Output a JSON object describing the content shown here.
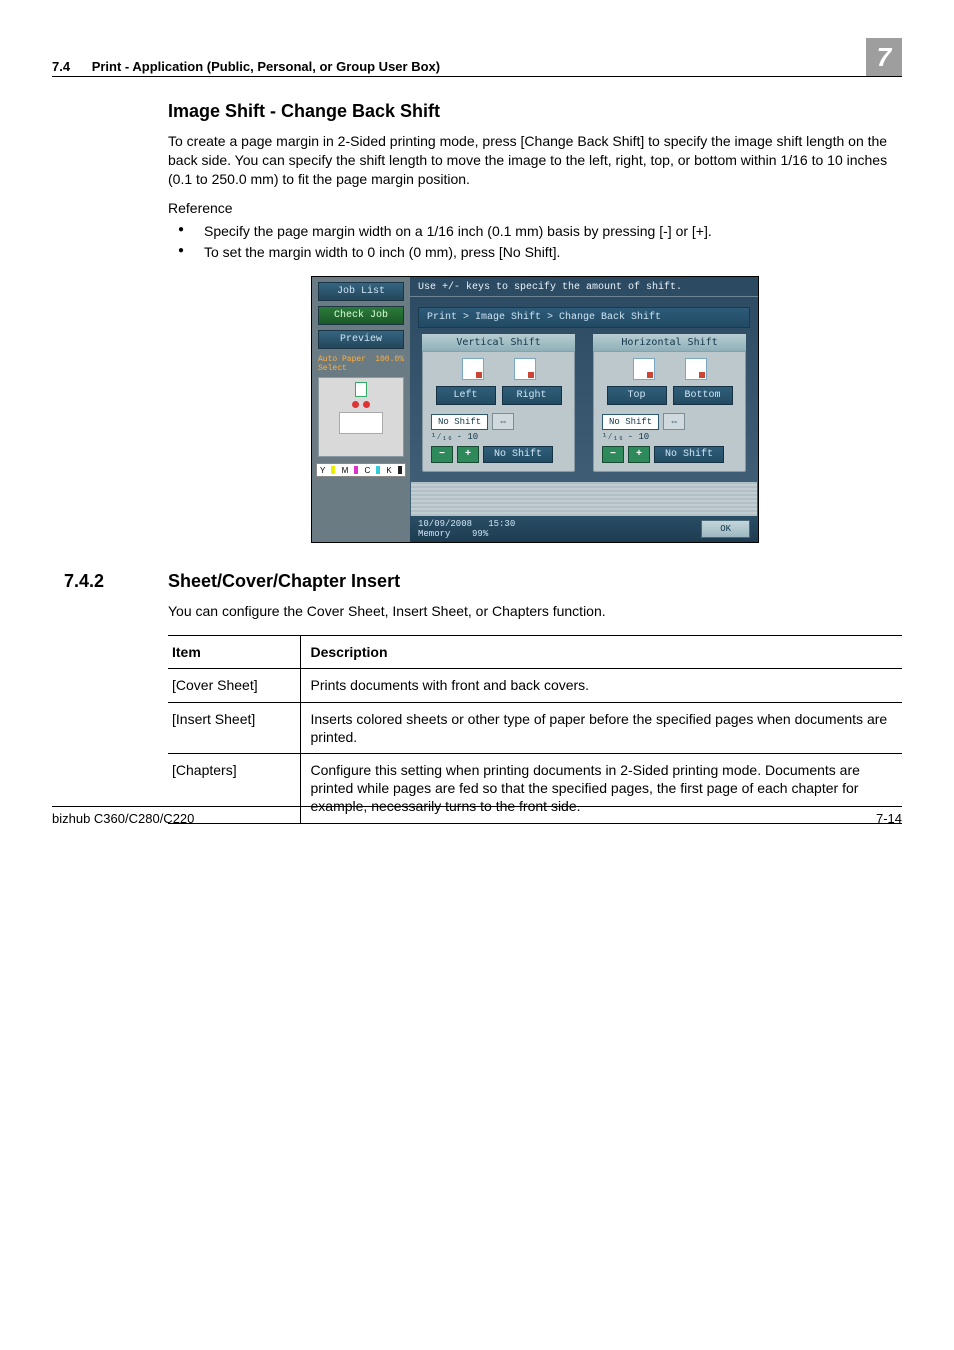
{
  "header": {
    "section_number": "7.4",
    "section_title": "Print - Application (Public, Personal, or Group User Box)",
    "chapter_tab": "7"
  },
  "image_shift": {
    "heading": "Image Shift - Change Back Shift",
    "paragraph": "To create a page margin in 2-Sided printing mode, press [Change Back Shift] to specify the image shift length on the back side. You can specify the shift length to move the image to the left, right, top, or bottom within 1/16 to 10 inches (0.1 to 250.0 mm) to fit the page margin position.",
    "reference_label": "Reference",
    "bullets": [
      "Specify the page margin width on a 1/16 inch (0.1 mm) basis by pressing [-] or [+].",
      "To set the margin width to 0 inch (0 mm), press [No Shift]."
    ]
  },
  "panel": {
    "left": {
      "job_list": "Job List",
      "check_job": "Check Job",
      "preview": "Preview",
      "status_left": "Auto Paper Select",
      "status_right": "100.0%",
      "cmyk": {
        "y": "Y",
        "m": "M",
        "c": "C",
        "k": "K"
      }
    },
    "right": {
      "top_message": "Use +/- keys to specify the amount of shift.",
      "breadcrumb": "Print > Image Shift > Change Back Shift",
      "vertical": {
        "head": "Vertical Shift",
        "left_btn": "Left",
        "right_btn": "Right",
        "no_shift": "No Shift",
        "swap": "⇔",
        "fraction": "¹⁄₁₆",
        "range": "-   10",
        "no_shift2": "No Shift"
      },
      "horizontal": {
        "head": "Horizontal Shift",
        "top_btn": "Top",
        "bottom_btn": "Bottom",
        "no_shift": "No Shift",
        "swap": "⇔",
        "fraction": "¹⁄₁₆",
        "range": "-   10",
        "no_shift2": "No Shift"
      },
      "footer": {
        "date": "10/09/2008",
        "time": "15:30",
        "memory_label": "Memory",
        "memory_value": "99%",
        "ok": "OK"
      }
    }
  },
  "sec742": {
    "number": "7.4.2",
    "heading": "Sheet/Cover/Chapter Insert",
    "intro": "You can configure the Cover Sheet, Insert Sheet, or Chapters function.",
    "table": {
      "head_item": "Item",
      "head_desc": "Description",
      "rows": [
        {
          "item": "[Cover Sheet]",
          "desc": "Prints documents with front and back covers."
        },
        {
          "item": "[Insert Sheet]",
          "desc": "Inserts colored sheets or other type of paper before the specified pages when documents are printed."
        },
        {
          "item": "[Chapters]",
          "desc": "Configure this setting when printing documents in 2-Sided printing mode. Documents are printed while pages are fed so that the specified pages, the first page of each chapter for example, necessarily turns to the front side."
        }
      ]
    }
  },
  "footer": {
    "left": "bizhub C360/C280/C220",
    "right": "7-14"
  }
}
